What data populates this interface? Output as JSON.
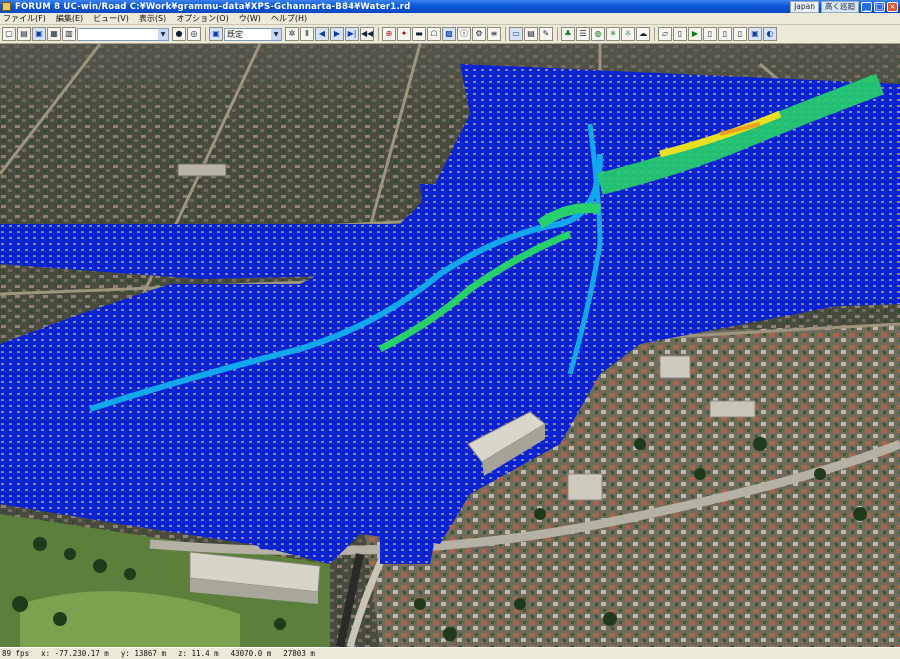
{
  "window": {
    "title": "FORUM 8   UC-win/Road   C:¥Work¥grammu-data¥XPS-Gchannarta-B84¥Water1.rd",
    "lang_badge": "Japan",
    "help_label": "高く巡廻",
    "buttons": {
      "minimize": "_",
      "maximize": "□",
      "close": "×"
    }
  },
  "menu": {
    "items": [
      "ファイル(F)",
      "編集(E)",
      "ビュー(V)",
      "表示(S)",
      "オプション(O)",
      "ウ(W)",
      "ヘルプ(H)"
    ]
  },
  "toolbar": {
    "search_value": "",
    "view_combo_value": "既定"
  },
  "status": {
    "cells": [
      "89 fps",
      "x: -77.230.17 m",
      "y: 13867 m",
      "z: 11.4 m",
      "43070.0 m",
      "27803 m"
    ]
  },
  "colors": {
    "flood_deep": "#0a1fd8",
    "flood_mid": "#12a8f0",
    "flood_shallow": "#26d06a",
    "flood_peak": "#e8e020"
  }
}
